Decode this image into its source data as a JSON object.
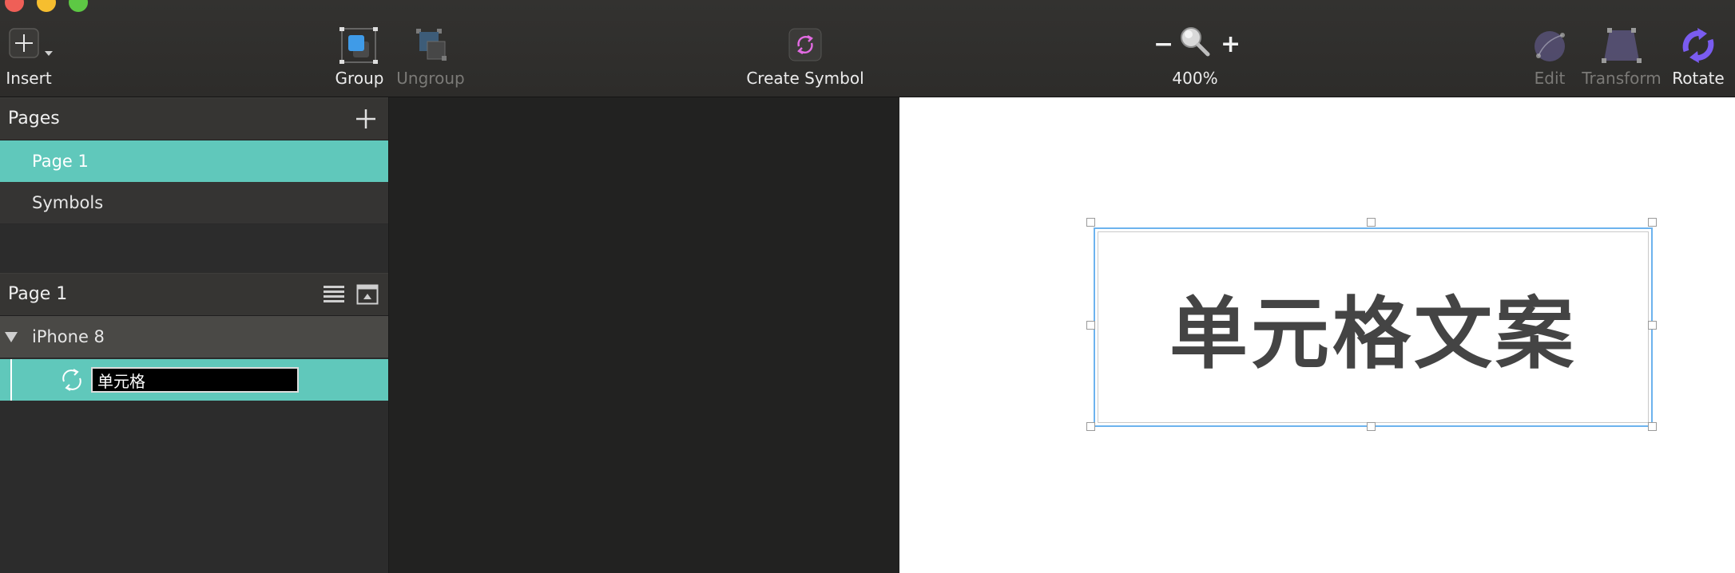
{
  "toolbar": {
    "insert_label": "Insert",
    "group_label": "Group",
    "ungroup_label": "Ungroup",
    "create_symbol_label": "Create Symbol",
    "zoom_minus": "−",
    "zoom_plus": "+",
    "zoom_level": "400%",
    "edit_label": "Edit",
    "transform_label": "Transform",
    "rotate_label": "Rotate"
  },
  "pages_panel": {
    "title": "Pages",
    "add_symbol": "+",
    "items": [
      {
        "label": "Page 1",
        "selected": true
      },
      {
        "label": "Symbols",
        "selected": false
      }
    ]
  },
  "layers_panel": {
    "title": "Page 1",
    "artboard": "iPhone 8",
    "layer_name_value": "单元格"
  },
  "canvas": {
    "symbol_text": "单元格文案"
  },
  "colors": {
    "accent_teal": "#60c8bb",
    "selection_blue": "#6db3ee",
    "toolbar_bg": "#302f2d"
  }
}
